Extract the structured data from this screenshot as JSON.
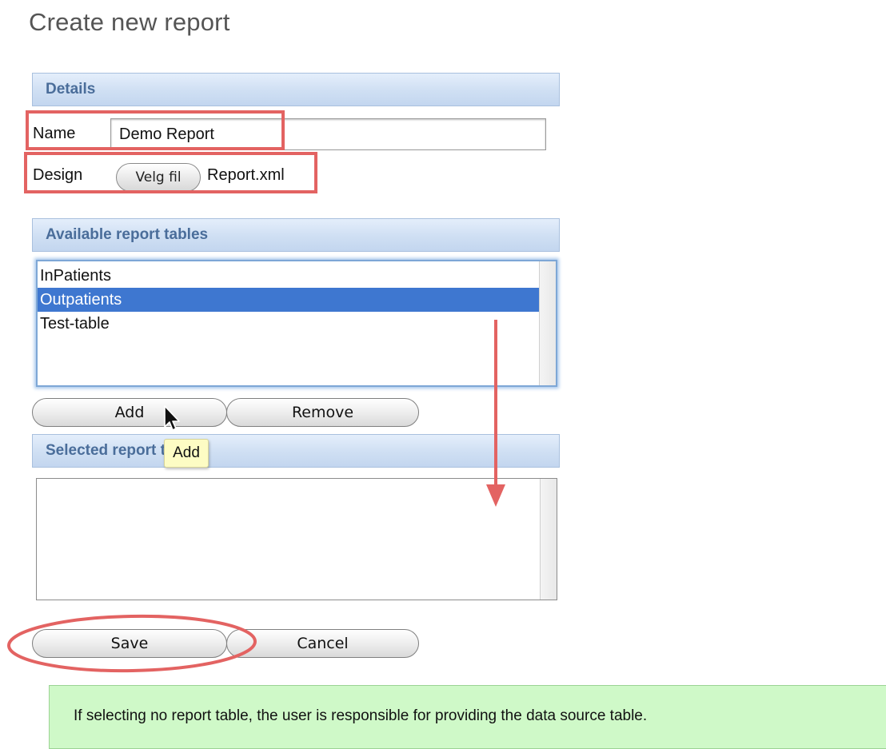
{
  "page": {
    "title": "Create new report"
  },
  "details": {
    "header": "Details",
    "name_label": "Name",
    "name_value": "Demo Report",
    "design_label": "Design",
    "file_button_label": "Velg fil",
    "file_name": "Report.xml"
  },
  "available_tables": {
    "header": "Available report tables",
    "items": [
      {
        "label": "InPatients",
        "selected": false
      },
      {
        "label": "Outpatients",
        "selected": true
      },
      {
        "label": "Test-table",
        "selected": false
      }
    ]
  },
  "list_actions": {
    "add_label": "Add",
    "remove_label": "Remove"
  },
  "tooltip": {
    "text": "Add"
  },
  "selected_tables": {
    "header": "Selected report tables",
    "items": []
  },
  "form_actions": {
    "save_label": "Save",
    "cancel_label": "Cancel"
  },
  "note": {
    "text": "If selecting no report table, the user is responsible for providing the data source table."
  },
  "colors": {
    "annotation": "#e36362",
    "selection": "#3e77d0",
    "note_background": "#cff9c8",
    "header_text": "#4a6d9a"
  }
}
